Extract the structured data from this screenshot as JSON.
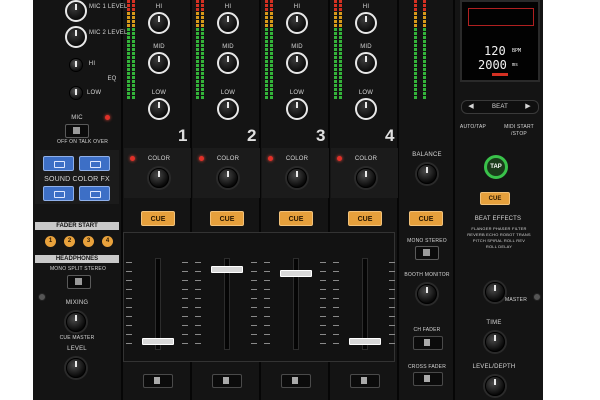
{
  "mic_section": {
    "mic1_label": "MIC 1 LEVEL",
    "mic2_label": "MIC 2 LEVEL",
    "eq_label": "EQ",
    "hi_label": "HI",
    "low_label": "LOW",
    "mic_label": "MIC",
    "mic_switch": "OFF  ON  TALK OVER"
  },
  "sound_color_fx_label": "SOUND COLOR FX",
  "fader_start": {
    "label": "FADER START",
    "buttons": [
      "1",
      "2",
      "3",
      "4"
    ]
  },
  "headphones": {
    "label": "HEADPHONES",
    "mode": "MONO SPLIT    STEREO",
    "mixing_label": "MIXING",
    "mixing_scale": "CUE      MASTER",
    "level_label": "LEVEL"
  },
  "channels": [
    {
      "number": "1",
      "hi": "HI",
      "mid": "MID",
      "low": "LOW",
      "color": "COLOR",
      "cue": "CUE"
    },
    {
      "number": "2",
      "hi": "HI",
      "mid": "MID",
      "low": "LOW",
      "color": "COLOR",
      "cue": "CUE"
    },
    {
      "number": "3",
      "hi": "HI",
      "mid": "MID",
      "low": "LOW",
      "color": "COLOR",
      "cue": "CUE"
    },
    {
      "number": "4",
      "hi": "HI",
      "mid": "MID",
      "low": "LOW",
      "color": "COLOR",
      "cue": "CUE"
    }
  ],
  "master": {
    "balance_label": "BALANCE",
    "cue_label": "CUE",
    "mono_stereo": "MONO STEREO",
    "booth_monitor_label": "BOOTH MONITOR",
    "ch_fader_label": "CH FADER",
    "cross_fader_label": "CROSS FADER"
  },
  "effects": {
    "display_bpm": "120",
    "display_bpm_unit": "BPM",
    "display_time": "2000",
    "display_time_unit": "ms",
    "beat_label": "BEAT",
    "auto_tap": "AUTO/TAP",
    "midi_start_stop": "MIDI START /STOP",
    "tap_label": "TAP",
    "cue_label": "CUE",
    "beat_effects_label": "BEAT EFFECTS",
    "effect_list": "FLANGER PHASER FILTER REVERB ECHO ROBOT TRANS PITCH SPIRAL ROLL REV ROLL DELAY",
    "master_label": "MASTER",
    "time_label": "TIME",
    "level_depth_label": "LEVEL/DEPTH"
  },
  "colors": {
    "panel": "#141414",
    "cue_orange": "#e6a03c",
    "fx_blue": "#3d6fc6",
    "meter_green": "#34b43a",
    "tap_green": "#39c24a",
    "led_red": "#e03028"
  }
}
